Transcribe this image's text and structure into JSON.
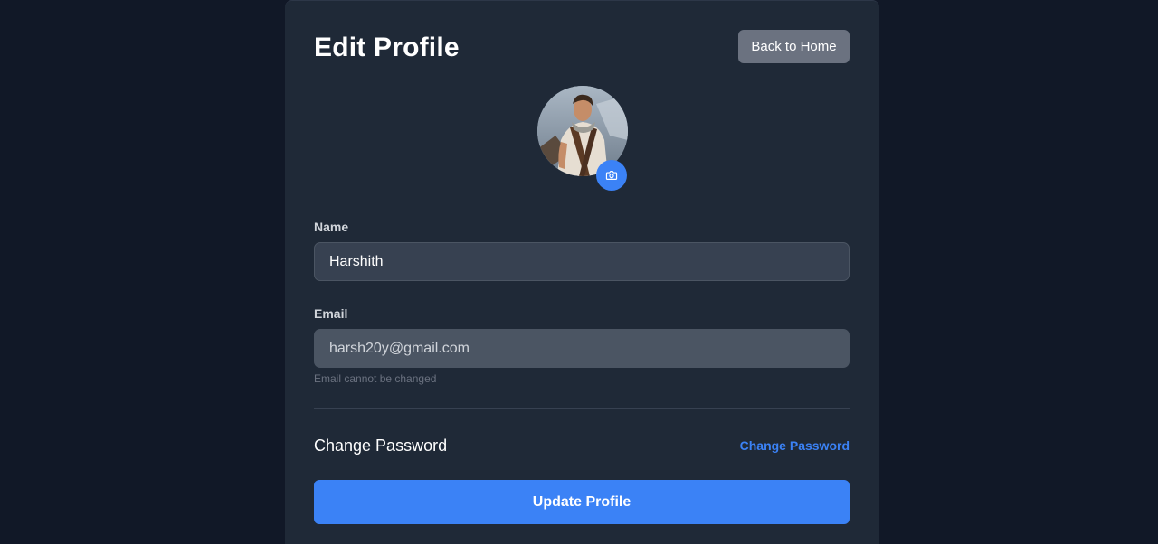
{
  "header": {
    "title": "Edit Profile",
    "back_label": "Back to Home"
  },
  "avatar": {
    "camera_icon": "camera-icon"
  },
  "form": {
    "name": {
      "label": "Name",
      "value": "Harshith"
    },
    "email": {
      "label": "Email",
      "value": "harsh20y@gmail.com",
      "helper": "Email cannot be changed"
    }
  },
  "password": {
    "section_title": "Change Password",
    "link_label": "Change Password"
  },
  "actions": {
    "submit_label": "Update Profile"
  },
  "colors": {
    "page_bg": "#111827",
    "card_bg": "#1f2937",
    "accent": "#3b82f6",
    "secondary_button": "#6b7280"
  }
}
